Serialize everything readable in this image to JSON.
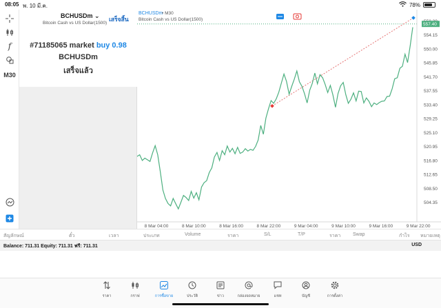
{
  "status_bar": {
    "time": "08:05",
    "date": "พ. 10 มี.ค.",
    "battery": "78%",
    "battery_level": 0.78
  },
  "left_toolbar": {
    "timeframe": "M30"
  },
  "order_panel": {
    "symbol": "BCHUSDm",
    "symbol_description": "Bitcoin Cash vs US Dollar(1500)",
    "done_label": "เสร็จสิ้น",
    "order_ticket": "#71185065 market",
    "order_side_volume": "buy 0.98",
    "order_symbol": "BCHUSDm",
    "order_status": "เสร็จแล้ว"
  },
  "chart_header": {
    "symbol": "BCHUSDm",
    "timeframe": "• M30",
    "description": "Bitcoin Cash vs US Dollar(1500)"
  },
  "chart_data": {
    "type": "line",
    "title": "",
    "xlabel": "",
    "ylabel": "",
    "ylim": [
      501,
      560
    ],
    "current_price": "557.40",
    "y_ticks": [
      "504.35",
      "508.50",
      "512.65",
      "516.80",
      "520.95",
      "525.10",
      "529.25",
      "533.40",
      "537.55",
      "541.70",
      "545.85",
      "550.00",
      "554.15",
      "558.30"
    ],
    "x_ticks": [
      "8 Mar 04:00",
      "8 Mar 10:00",
      "8 Mar 16:00",
      "8 Mar 22:00",
      "9 Mar 04:00",
      "9 Mar 10:00",
      "9 Mar 16:00",
      "9 Mar 22:00"
    ],
    "series": [
      {
        "values": [
          518.0,
          518.5,
          516.8,
          517.5,
          517.0,
          516.5,
          519.0,
          521.2,
          518.5,
          513.5,
          508.0,
          505.5,
          504.0,
          503.3,
          505.5,
          503.9,
          502.4,
          504.4,
          506.4,
          505.8,
          504.9,
          507.6,
          505.6,
          507.2,
          505.1,
          508.9,
          510.2,
          510.8,
          513.2,
          514.6,
          517.8,
          519.2,
          516.8,
          519.7,
          518.5,
          521.1,
          519.3,
          520.4,
          518.8,
          520.7,
          518.9,
          519.3,
          520.3,
          519.6,
          520.1,
          519.8,
          521.0,
          522.9,
          527.2,
          524.6,
          529.4,
          532.2,
          534.6,
          533.8,
          535.1,
          537.1,
          539.8,
          542.5,
          540.3,
          536.5,
          538.8,
          540.9,
          543.4,
          540.2,
          538.8,
          536.6,
          533.9,
          537.7,
          539.7,
          542.8,
          539.6,
          542.3,
          541.4,
          539.4,
          537.0,
          539.1,
          536.3,
          532.6,
          536.7,
          539.0,
          540.0,
          536.4,
          533.8,
          535.0,
          536.9,
          534.5,
          537.4,
          537.3,
          533.9,
          535.4,
          534.4,
          532.8,
          533.9,
          533.4,
          534.0,
          534.4,
          534.5,
          535.8,
          535.9,
          538.1,
          541.1,
          541.4,
          544.2,
          544.8,
          548.4,
          545.9,
          550.9,
          556.4
        ]
      }
    ],
    "trade_markers": [
      {
        "type": "entry",
        "value": 533.0,
        "color": "#e53935"
      },
      {
        "type": "exit",
        "value": 557.4,
        "color": "#1e88e5"
      }
    ],
    "line_color": "#4caf7f"
  },
  "table_header": [
    "สัญลักษณ์",
    "ตั๋ว",
    "เวลา",
    "ประเภท",
    "Volume",
    "ราคา",
    "S/L",
    "T/P",
    "ราคา",
    "Swap",
    "กำไร",
    "หมายเหตุ"
  ],
  "balance": {
    "text": "Balance: 711.31 Equity: 711.31 ฟรี: 711.31",
    "currency": "USD"
  },
  "tabs": [
    {
      "id": "quotes",
      "label": "ราคา",
      "icon": "quotes-icon"
    },
    {
      "id": "chart",
      "label": "กราฟ",
      "icon": "candles-icon"
    },
    {
      "id": "trade",
      "label": "การซื้อขาย",
      "icon": "trade-icon",
      "active": true
    },
    {
      "id": "history",
      "label": "ประวัติ",
      "icon": "history-icon"
    },
    {
      "id": "news",
      "label": "ข่าว",
      "icon": "news-icon"
    },
    {
      "id": "mailbox",
      "label": "กล่องจดหมาย",
      "icon": "mail-icon"
    },
    {
      "id": "chat",
      "label": "แชท",
      "icon": "chat-icon"
    },
    {
      "id": "accounts",
      "label": "บัญชี",
      "icon": "account-icon"
    },
    {
      "id": "settings",
      "label": "การตั้งค่า",
      "icon": "gear-icon"
    }
  ],
  "colors": {
    "accent": "#1e88e5",
    "line": "#4caf7f",
    "entry": "#e53935",
    "exit": "#1e88e5"
  }
}
